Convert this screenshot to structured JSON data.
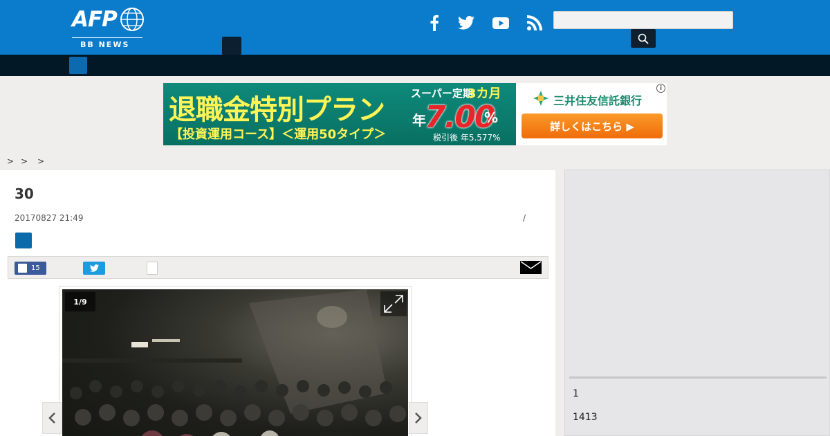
{
  "header": {
    "logo_main": "AFP",
    "logo_sub": "BB NEWS",
    "social_icons": [
      "facebook-icon",
      "twitter-icon",
      "youtube-icon",
      "rss-icon"
    ],
    "search_placeholder": ""
  },
  "ad": {
    "title": "退職金特別プラン",
    "subtitle": "【投資運用コース】＜運用50タイプ＞",
    "super_term": "スーパー定期",
    "term": "3カ月",
    "year": "年",
    "rate": "7.00",
    "percent": "%",
    "after_tax": "税引後 年5.577%",
    "bank": "三井住友信託銀行",
    "cta": "詳しくはこちら ▶",
    "info": "i"
  },
  "breadcrumb": [
    ">",
    ">",
    ">"
  ],
  "article": {
    "title": "30",
    "date": "20170827 21:49",
    "separator": "/",
    "facebook_count": "15",
    "gallery_counter": "1/9"
  },
  "sidebar": {
    "item1": "1",
    "item2": "1413"
  },
  "colors": {
    "header_blue": "#0b7ccb",
    "nav_dark": "#031826",
    "facebook": "#3b5a9a",
    "twitter": "#1d9be0"
  }
}
